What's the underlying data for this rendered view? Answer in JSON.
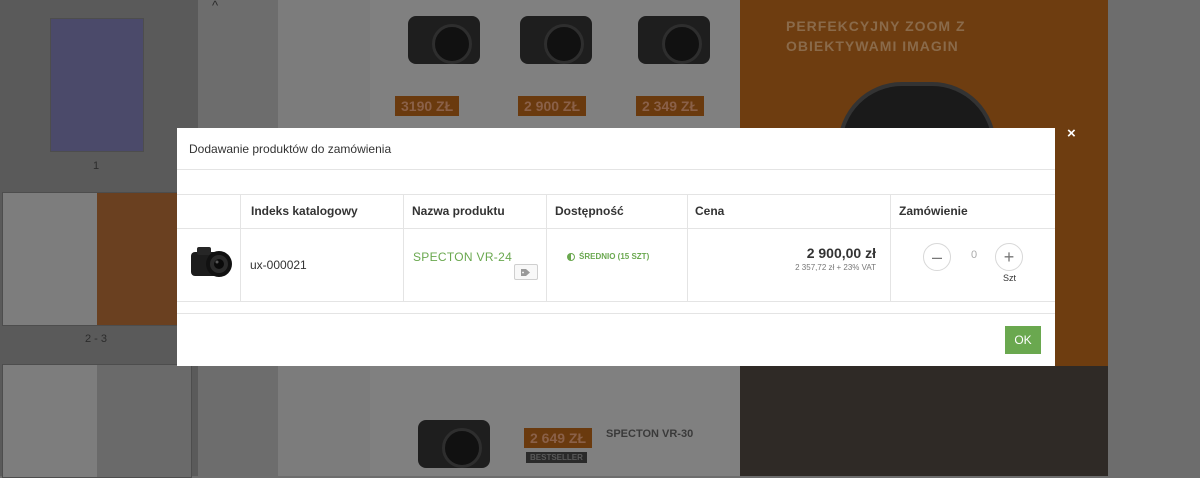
{
  "viewer": {
    "thumbnails": [
      {
        "label": "1"
      },
      {
        "label": "2 - 3"
      }
    ],
    "page_left": {
      "prices": [
        "3190 ZŁ",
        "2 900 ZŁ",
        "2 349 ZŁ"
      ],
      "promo_price": "2 649 ZŁ",
      "promo_badge": "BESTSELLER",
      "promo_model": "SPECTON VR-30"
    },
    "page_right": {
      "title": "PERFEKCYJNY ZOOM Z OBIEKTYWAMI IMAGIN"
    }
  },
  "modal": {
    "title": "Dodawanie produktów do zamówienia",
    "close_label": "×",
    "columns": [
      "Indeks katalogowy",
      "Nazwa produktu",
      "Dostępność",
      "Cena",
      "Zamówienie"
    ],
    "rows": [
      {
        "index": "ux-000021",
        "name": "SPECTON  VR-24",
        "availability": "ŚREDNIO  (15 SZT)",
        "price": "2 900,00 zł",
        "price_net": "2 357,72 zł + 23%  VAT",
        "quantity": "0",
        "unit": "Szt",
        "minus_label": "–",
        "plus_label": "+"
      }
    ],
    "ok_label": "OK"
  },
  "colors": {
    "accent_green": "#6aa84f",
    "overlay": "#6d6d6d",
    "promo_orange": "#6e3d10"
  }
}
